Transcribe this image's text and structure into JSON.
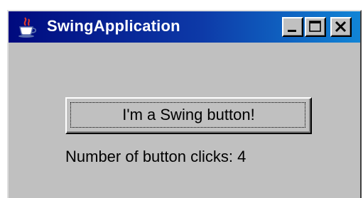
{
  "window": {
    "title": "SwingApplication",
    "controls": {
      "minimize": "minimize-icon",
      "maximize": "maximize-icon",
      "close": "close-icon"
    }
  },
  "colors": {
    "title_bar_start": "#000a7e",
    "title_bar_end": "#1185d6",
    "window_background": "#c0c0c0"
  },
  "app_icon": "java-coffee-cup-icon",
  "main": {
    "button_label": "I'm a Swing button!",
    "clicks_label": "Number of button clicks: 4"
  }
}
